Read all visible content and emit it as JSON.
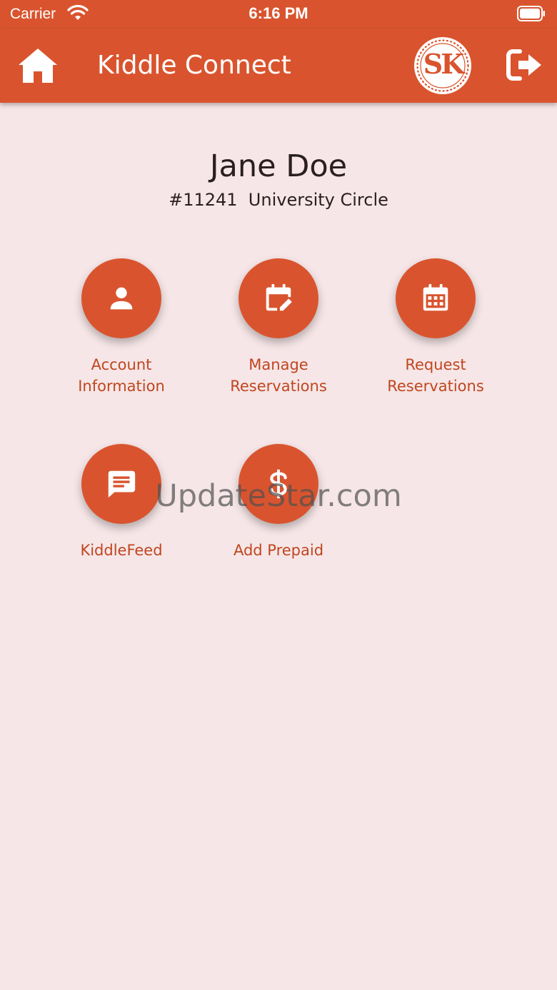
{
  "status_bar": {
    "carrier": "Carrier",
    "time": "6:16 PM"
  },
  "app_bar": {
    "title": "Kiddle Connect",
    "logo_text": "SK",
    "home_icon": "home-icon",
    "logout_icon": "logout-icon"
  },
  "profile": {
    "name": "Jane Doe",
    "subtitle": "#11241  University Circle"
  },
  "tiles": [
    {
      "line1": "Account",
      "line2": "Information",
      "icon": "person-icon"
    },
    {
      "line1": "Manage",
      "line2": "Reservations",
      "icon": "calendar-edit-icon"
    },
    {
      "line1": "Request",
      "line2": "Reservations",
      "icon": "calendar-icon"
    },
    {
      "line1": "KiddleFeed",
      "line2": "",
      "icon": "chat-icon"
    },
    {
      "line1": "Add Prepaid",
      "line2": "",
      "icon": "dollar-icon"
    }
  ],
  "watermark": "UpdateStar.com",
  "colors": {
    "brand": "#d9542e",
    "background": "#f6e6e7",
    "label": "#c0461f"
  }
}
